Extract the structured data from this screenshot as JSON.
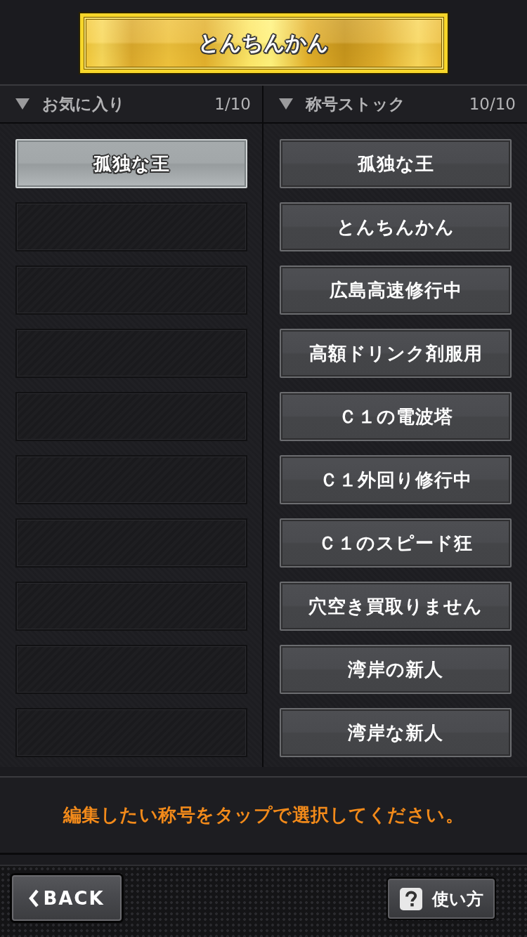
{
  "current_title": {
    "label": "とんちんかん"
  },
  "favorites": {
    "heading": "お気に入り",
    "count": "1/10",
    "slots": [
      {
        "kind": "title",
        "label": "孤独な王",
        "selected": true
      },
      {
        "kind": "empty",
        "selected": false
      },
      {
        "kind": "empty",
        "selected": false
      },
      {
        "kind": "empty",
        "selected": false
      },
      {
        "kind": "empty",
        "selected": false
      },
      {
        "kind": "empty",
        "selected": false
      },
      {
        "kind": "empty",
        "selected": false
      },
      {
        "kind": "empty",
        "selected": false
      },
      {
        "kind": "empty",
        "selected": false
      },
      {
        "kind": "empty",
        "selected": false
      }
    ]
  },
  "stock": {
    "heading": "称号ストック",
    "count": "10/10",
    "items": [
      {
        "label": "孤独な王",
        "selected": false
      },
      {
        "label": "とんちんかん",
        "selected": false
      },
      {
        "label": "広島高速修行中",
        "selected": false
      },
      {
        "label": "高額ドリンク剤服用",
        "selected": false
      },
      {
        "label": "Ｃ１の電波塔",
        "selected": false
      },
      {
        "label": "Ｃ１外回り修行中",
        "selected": false
      },
      {
        "label": "Ｃ１のスピード狂",
        "selected": false
      },
      {
        "label": "穴空き買取りません",
        "selected": false
      },
      {
        "label": "湾岸の新人",
        "selected": false
      },
      {
        "label": "湾岸な新人",
        "selected": false
      }
    ]
  },
  "message": "編集したい称号をタップで選択してください。",
  "toolbar": {
    "back": "BACK",
    "help": "使い方"
  }
}
